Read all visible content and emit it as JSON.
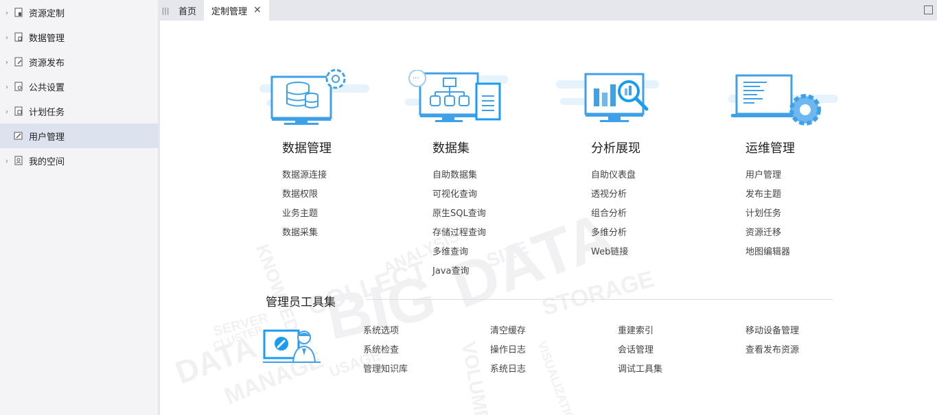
{
  "sidebar": {
    "items": [
      {
        "label": "资源定制",
        "icon": "document-icon"
      },
      {
        "label": "数据管理",
        "icon": "database-doc-icon"
      },
      {
        "label": "资源发布",
        "icon": "publish-icon"
      },
      {
        "label": "公共设置",
        "icon": "settings-doc-icon"
      },
      {
        "label": "计划任务",
        "icon": "schedule-icon"
      },
      {
        "label": "用户管理",
        "icon": "user-doc-icon",
        "active": true
      },
      {
        "label": "我的空间",
        "icon": "personal-space-icon"
      }
    ]
  },
  "tabs": {
    "home": "首页",
    "custom": "定制管理",
    "close_symbol": "✕"
  },
  "modules": [
    {
      "title": "数据管理",
      "links": [
        "数据源连接",
        "数据权限",
        "业务主题",
        "数据采集"
      ]
    },
    {
      "title": "数据集",
      "links": [
        "自助数据集",
        "可视化查询",
        "原生SQL查询",
        "存储过程查询",
        "多维查询",
        "Java查询"
      ]
    },
    {
      "title": "分析展现",
      "links": [
        "自助仪表盘",
        "透视分析",
        "组合分析",
        "多维分析",
        "Web链接"
      ]
    },
    {
      "title": "运维管理",
      "links": [
        "用户管理",
        "发布主题",
        "计划任务",
        "资源迁移",
        "地图编辑器"
      ]
    }
  ],
  "admin": {
    "title": "管理员工具集",
    "columns": [
      [
        "系统选项",
        "系统检查",
        "管理知识库"
      ],
      [
        "清空缓存",
        "操作日志",
        "系统日志"
      ],
      [
        "重建索引",
        "会话管理",
        "调试工具集"
      ],
      [
        "移动设备管理",
        "查看发布资源"
      ]
    ]
  },
  "colors": {
    "accent": "#1a9cf0",
    "icon_light": "#d9ecfb",
    "icon_mid": "#6fb8ef",
    "sidebar_bg": "#f4f4f6",
    "active_bg": "#dde2ef"
  }
}
